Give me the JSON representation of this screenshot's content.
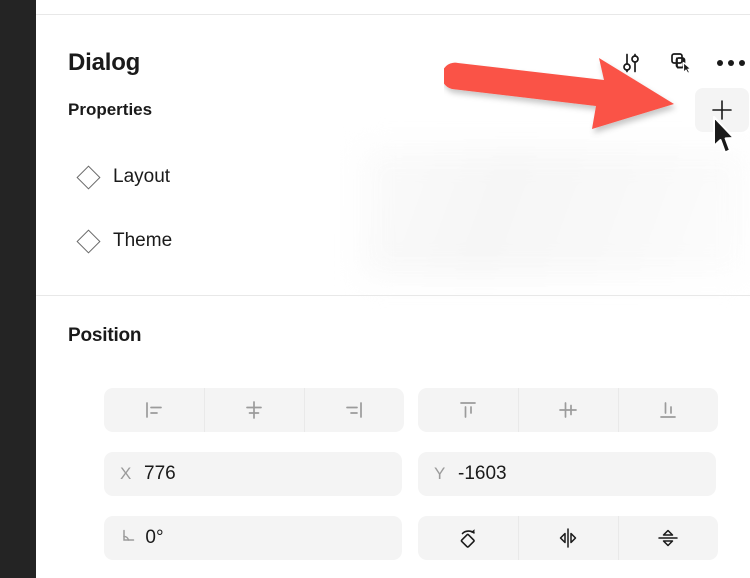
{
  "window": {
    "rail_color": "#242424",
    "background": "#ffffff"
  },
  "header": {
    "title": "Dialog",
    "subtitle": "Properties",
    "icons": [
      {
        "name": "sliders-icon",
        "label": "Settings"
      },
      {
        "name": "components-cursor-icon",
        "label": "Components"
      },
      {
        "name": "more-options-icon",
        "label": "More options"
      }
    ],
    "add_button_label": "+"
  },
  "properties": {
    "variants": [
      {
        "icon": "diamond-icon",
        "label": "Layout"
      },
      {
        "icon": "diamond-icon",
        "label": "Theme"
      }
    ]
  },
  "position": {
    "title": "Position",
    "align_horizontal": [
      {
        "name": "align-left-icon",
        "label": "Align left"
      },
      {
        "name": "align-horizontal-center-icon",
        "label": "Align horizontal centers"
      },
      {
        "name": "align-right-icon",
        "label": "Align right"
      }
    ],
    "align_vertical": [
      {
        "name": "align-top-icon",
        "label": "Align top"
      },
      {
        "name": "align-vertical-center-icon",
        "label": "Align vertical centers"
      },
      {
        "name": "align-bottom-icon",
        "label": "Align bottom"
      }
    ],
    "fields": {
      "x": {
        "key": "X",
        "value": "776"
      },
      "y": {
        "key": "Y",
        "value": "-1603"
      },
      "rotation": {
        "key": "angle-icon",
        "value": "0°"
      }
    },
    "transforms": [
      {
        "name": "rotate-90-icon",
        "label": "Rotate 90°"
      },
      {
        "name": "flip-horizontal-icon",
        "label": "Flip horizontal"
      },
      {
        "name": "flip-vertical-icon",
        "label": "Flip vertical"
      }
    ]
  },
  "annotation": {
    "arrow_color": "#FA5246",
    "points_to": "add-property-button"
  }
}
